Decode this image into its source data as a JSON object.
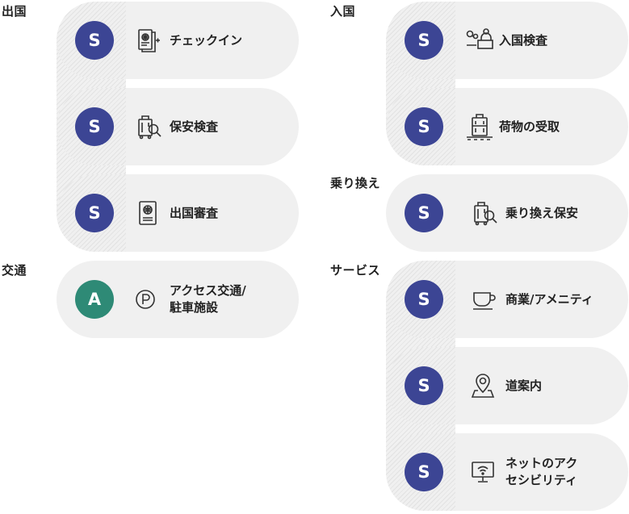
{
  "sections": {
    "departure": {
      "title": "出国",
      "items": [
        {
          "grade": "S",
          "icon": "check-in-icon",
          "label": "チェックイン"
        },
        {
          "grade": "S",
          "icon": "security-check-icon",
          "label": "保安検査"
        },
        {
          "grade": "S",
          "icon": "passport-icon",
          "label": "出国審査"
        }
      ]
    },
    "arrival": {
      "title": "入国",
      "items": [
        {
          "grade": "S",
          "icon": "immigration-counter-icon",
          "label": "入国検査"
        },
        {
          "grade": "S",
          "icon": "baggage-claim-icon",
          "label": "荷物の受取"
        }
      ]
    },
    "transit": {
      "title": "交通",
      "items": [
        {
          "grade": "A",
          "icon": "parking-icon",
          "label": "アクセス交通/\n駐車施設"
        }
      ]
    },
    "transfer": {
      "title": "乗り換え",
      "items": [
        {
          "grade": "S",
          "icon": "transfer-security-icon",
          "label": "乗り換え保安"
        }
      ]
    },
    "service": {
      "title": "サービス",
      "items": [
        {
          "grade": "S",
          "icon": "coffee-cup-icon",
          "label": "商業/アメニティ"
        },
        {
          "grade": "S",
          "icon": "location-pin-icon",
          "label": "道案内"
        },
        {
          "grade": "S",
          "icon": "wifi-monitor-icon",
          "label": "ネットのアク\nセシビリティ"
        }
      ]
    }
  },
  "colors": {
    "badge_s": "#3c4594",
    "badge_a": "#2e8a76",
    "pill_bg": "#f0f0f0"
  }
}
